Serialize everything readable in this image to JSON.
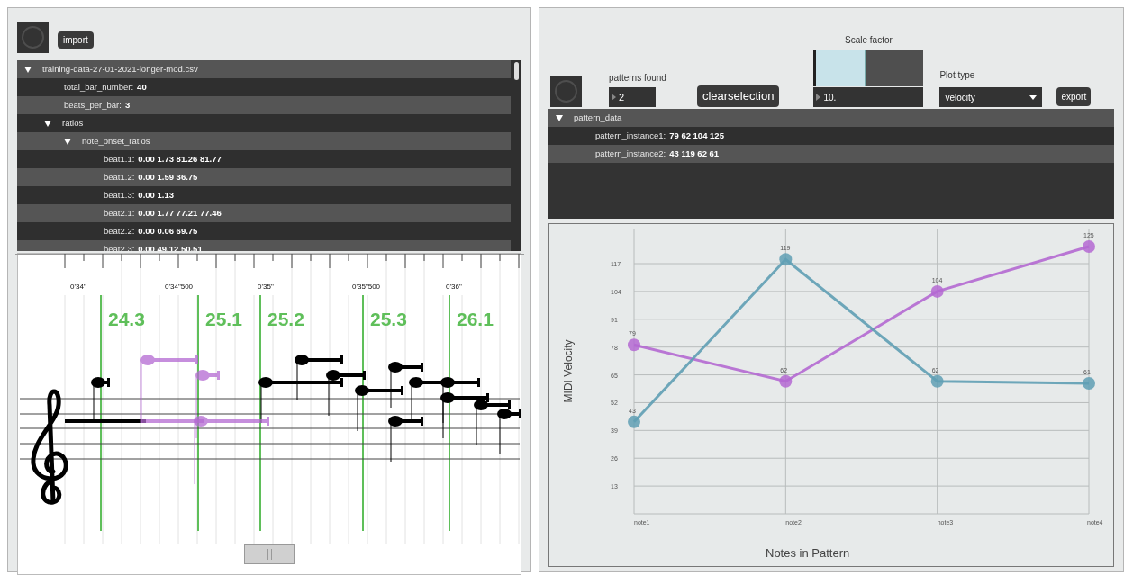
{
  "left_panel": {
    "toggle": {
      "on": false
    },
    "import_button": "import",
    "tree": [
      {
        "label": "training-data-27-01-2021-longer-mod.csv",
        "expanded": true,
        "children": [
          {
            "label": "total_bar_number:",
            "value": "40"
          },
          {
            "label": "beats_per_bar:",
            "value": "3"
          },
          {
            "label": "ratios",
            "expanded": true,
            "children": [
              {
                "label": "note_onset_ratios",
                "expanded": true,
                "children": [
                  {
                    "label": "beat1.1:",
                    "value": "0.00 1.73 81.26 81.77"
                  },
                  {
                    "label": "beat1.2:",
                    "value": "0.00 1.59 36.75"
                  },
                  {
                    "label": "beat1.3:",
                    "value": "0.00 1.13"
                  },
                  {
                    "label": "beat2.1:",
                    "value": "0.00 1.77 77.21 77.46"
                  },
                  {
                    "label": "beat2.2:",
                    "value": "0.00 0.06 69.75"
                  },
                  {
                    "label": "beat2.3:",
                    "value": "0.00 49.12 50.51"
                  }
                ]
              }
            ]
          }
        ]
      }
    ],
    "score": {
      "time_labels": [
        "0'34\"",
        "0'34\"500",
        "0'35\"",
        "0'35\"500",
        "0'36\""
      ],
      "markers": [
        "24.3",
        "25.1",
        "25.2",
        "25.3",
        "26.1"
      ]
    }
  },
  "right_panel": {
    "toggle": {
      "on": false
    },
    "patterns_found": {
      "label": "patterns found",
      "value": "2"
    },
    "clear_button": "clearselection",
    "scale_factor": {
      "label": "Scale factor",
      "level": 0.47,
      "value": "10."
    },
    "plot_type": {
      "label": "Plot type",
      "value": "velocity"
    },
    "export_button": "export",
    "tree": [
      {
        "label": "pattern_data",
        "expanded": true,
        "children": [
          {
            "label": "pattern_instance1:",
            "value": "79 62 104 125"
          },
          {
            "label": "pattern_instance2:",
            "value": "43 119 62 61"
          }
        ]
      }
    ],
    "chart_data": {
      "type": "line",
      "xlabel": "Notes in Pattern",
      "ylabel": "MIDI Velocity",
      "categories": [
        "note1",
        "note2",
        "note3",
        "note4"
      ],
      "series": [
        {
          "color": "#b469d2",
          "marker": "circle",
          "values": [
            79,
            62,
            104,
            125
          ]
        },
        {
          "color": "#5f9fb4",
          "marker": "circle",
          "values": [
            43,
            119,
            62,
            61
          ]
        }
      ],
      "grid": true,
      "ylim": [
        0,
        133
      ],
      "yticks": [
        13,
        26,
        39,
        52,
        65,
        78,
        91,
        104,
        117
      ],
      "data_labels": true
    }
  }
}
